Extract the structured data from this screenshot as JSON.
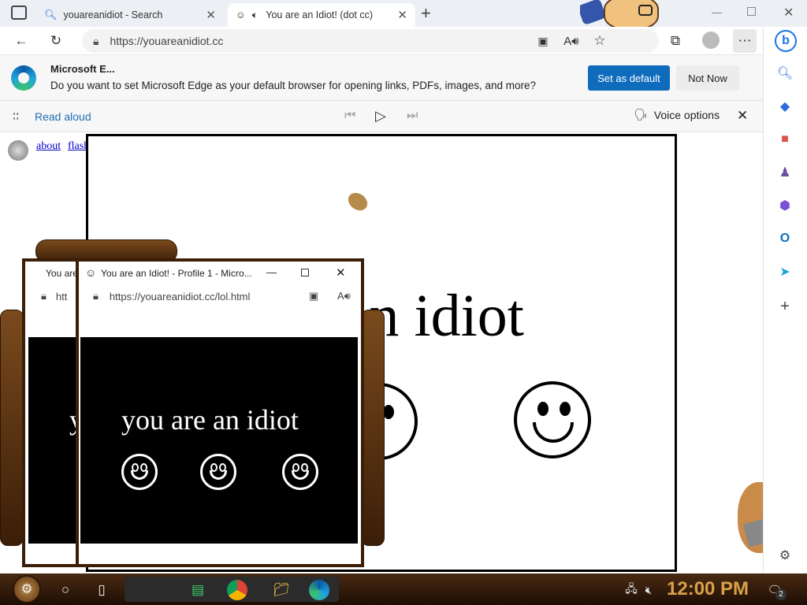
{
  "tabs": [
    {
      "title": "youareanidiot - Search",
      "active": false
    },
    {
      "title": "You are an Idiot! (dot cc)",
      "active": true
    }
  ],
  "address": {
    "url": "https://youareanidiot.cc"
  },
  "infobar": {
    "title": "Microsoft E...",
    "message": "Do you want to set Microsoft Edge as your default browser for opening links, PDFs, images, and more?",
    "primary_button": "Set as default",
    "secondary_button": "Not Now"
  },
  "read_aloud": {
    "label": "Read aloud",
    "voice_options": "Voice options"
  },
  "page": {
    "links": [
      "about",
      "flash"
    ],
    "headline": "e an idiot"
  },
  "popup_front": {
    "title": "You are an Idiot! - Profile 1 - Micro...",
    "url": "https://youareanidiot.cc/lol.html",
    "text": "you are an idiot"
  },
  "popup_back": {
    "title": "You are",
    "url": "htt",
    "text": "y"
  },
  "taskbar": {
    "clock": "12:00 PM",
    "notification_count": "2"
  },
  "colors": {
    "accent": "#0f6cbd",
    "link": "#1f6db3",
    "taskbar": "#3b1e08",
    "clock": "#d8a14a"
  }
}
